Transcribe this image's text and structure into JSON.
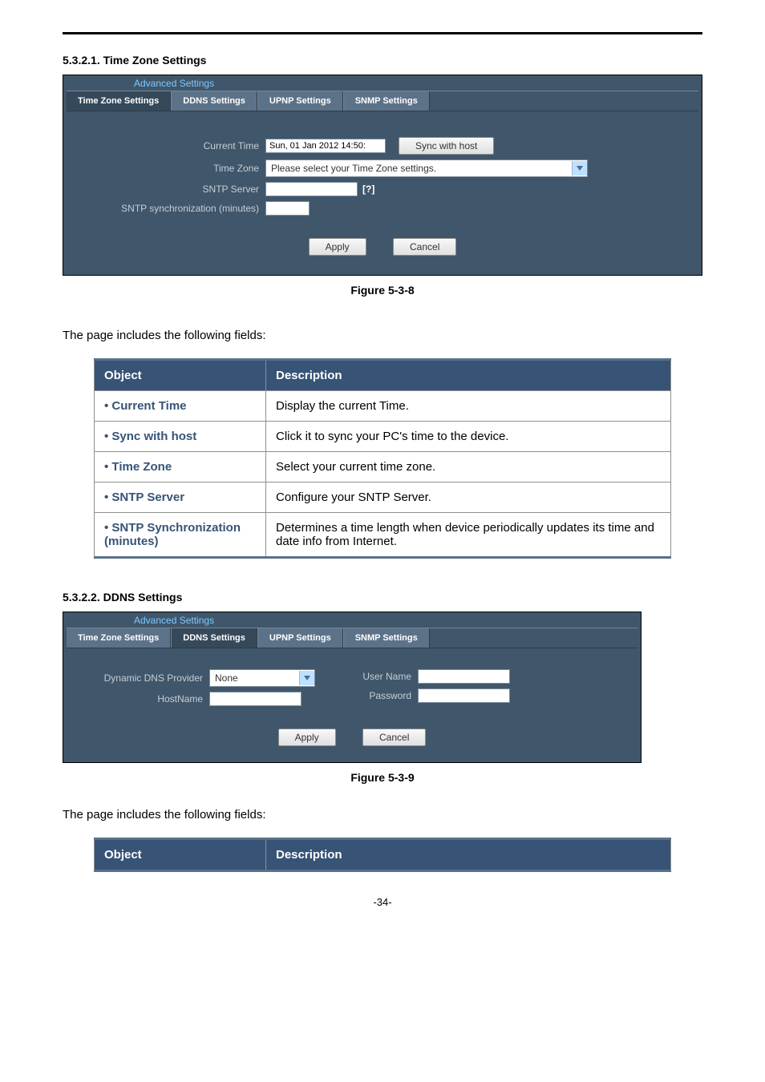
{
  "section1": {
    "number": "5.3.2.1.",
    "title": "Time Zone Settings",
    "panel_title": "Advanced Settings",
    "tabs": {
      "tz": "Time Zone Settings",
      "ddns": "DDNS Settings",
      "upnp": "UPNP Settings",
      "snmp": "SNMP Settings"
    },
    "labels": {
      "current_time": "Current Time",
      "time_zone": "Time Zone",
      "sntp_server": "SNTP Server",
      "sntp_sync": "SNTP synchronization (minutes)"
    },
    "values": {
      "current_time": "Sun, 01 Jan 2012 14:50:",
      "time_zone": "Please select your Time Zone settings.",
      "sntp_server": "",
      "sntp_sync": ""
    },
    "buttons": {
      "sync": "Sync with host",
      "apply": "Apply",
      "cancel": "Cancel"
    },
    "help": "[?]",
    "caption": "Figure 5-3-8"
  },
  "table_intro": "The page includes the following fields:",
  "table1": {
    "headers": {
      "obj": "Object",
      "desc": "Description"
    },
    "rows": [
      {
        "obj": "Current Time",
        "desc": "Display the current Time."
      },
      {
        "obj": "Sync with host",
        "desc": "Click it to sync your PC's time to the device."
      },
      {
        "obj": "Time Zone",
        "desc": "Select your current time zone."
      },
      {
        "obj": "SNTP Server",
        "desc": "Configure your SNTP Server."
      },
      {
        "obj": "SNTP Synchronization (minutes)",
        "desc": "Determines a time length when device periodically updates its time and date info from Internet."
      }
    ]
  },
  "section2": {
    "number": "5.3.2.2.",
    "title": "DDNS Settings",
    "panel_title": "Advanced Settings",
    "tabs": {
      "tz": "Time Zone Settings",
      "ddns": "DDNS Settings",
      "upnp": "UPNP Settings",
      "snmp": "SNMP Settings"
    },
    "labels": {
      "provider": "Dynamic DNS Provider",
      "hostname": "HostName",
      "username": "User Name",
      "password": "Password"
    },
    "values": {
      "provider": "None",
      "hostname": "",
      "username": "",
      "password": ""
    },
    "buttons": {
      "apply": "Apply",
      "cancel": "Cancel"
    },
    "caption": "Figure 5-3-9"
  },
  "table2": {
    "headers": {
      "obj": "Object",
      "desc": "Description"
    }
  },
  "page_number": "-34-"
}
